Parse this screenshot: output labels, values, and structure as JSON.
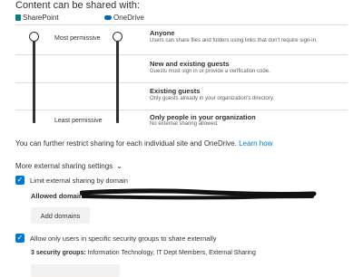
{
  "heading": "Content can be shared with:",
  "apps": [
    {
      "name": "SharePoint",
      "color": "#038387"
    },
    {
      "name": "OneDrive",
      "color": "#0364b8"
    }
  ],
  "slider": {
    "top_label": "Most permissive",
    "bottom_label": "Least permissive",
    "sharepoint_level": "Anyone",
    "onedrive_level": "Anyone"
  },
  "levels": [
    {
      "title": "Anyone",
      "description": "Users can share files and folders using links that don't require sign-in."
    },
    {
      "title": "New and existing guests",
      "description": "Guests must sign in or provide a verification code."
    },
    {
      "title": "Existing guests",
      "description": "Only guests already in your organization's directory."
    },
    {
      "title": "Only people in your organization",
      "description": "No external sharing allowed."
    }
  ],
  "note": {
    "text": "You can further restrict sharing for each individual site and OneDrive.",
    "link": "Learn how"
  },
  "more_settings": {
    "label": "More external sharing settings",
    "expanded": true
  },
  "limit_by_domain": {
    "label": "Limit external sharing by domain",
    "checked": true,
    "allowed_domains_label": "Allowed domains:",
    "add_button": "Add domains"
  },
  "security_groups": {
    "label": "Allow only users in specific security groups to share externally",
    "checked": true,
    "count_label": "3 security groups:",
    "groups": "Information Technology, IT Dept Members, External Sharing"
  },
  "colors": {
    "accent": "#0078d4",
    "text": "#323130",
    "divider": "#e1dfdd"
  }
}
